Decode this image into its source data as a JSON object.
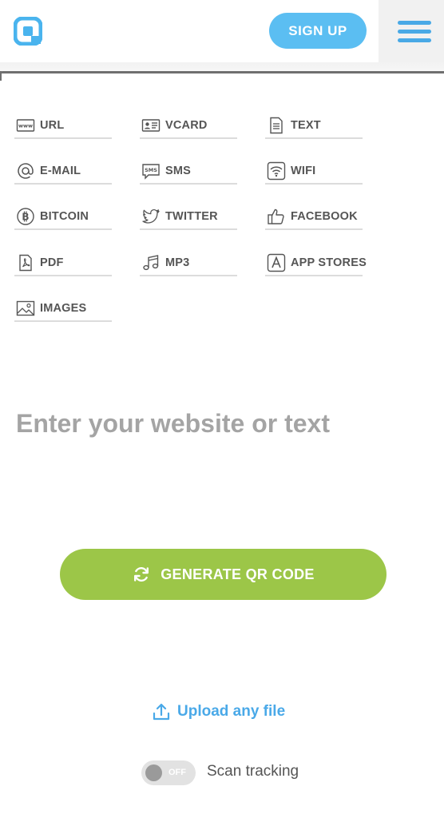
{
  "header": {
    "signup_label": "SIGN UP",
    "logo_icon": "rounded-square-logo-icon",
    "menu_icon": "hamburger-menu-icon",
    "brand_color": "#5bbef2"
  },
  "types": [
    {
      "label": "URL",
      "icon": "www-icon"
    },
    {
      "label": "VCARD",
      "icon": "vcard-icon"
    },
    {
      "label": "TEXT",
      "icon": "document-icon"
    },
    {
      "label": "E-MAIL",
      "icon": "at-icon"
    },
    {
      "label": "SMS",
      "icon": "sms-bubble-icon"
    },
    {
      "label": "WIFI",
      "icon": "wifi-icon"
    },
    {
      "label": "BITCOIN",
      "icon": "bitcoin-icon"
    },
    {
      "label": "TWITTER",
      "icon": "twitter-bird-icon"
    },
    {
      "label": "FACEBOOK",
      "icon": "thumbs-up-icon"
    },
    {
      "label": "PDF",
      "icon": "pdf-file-icon"
    },
    {
      "label": "MP3",
      "icon": "music-note-icon"
    },
    {
      "label": "APP STORES",
      "icon": "app-store-icon"
    },
    {
      "label": "IMAGES",
      "icon": "image-icon"
    }
  ],
  "input": {
    "placeholder": "Enter your website or text",
    "value": ""
  },
  "generate": {
    "label": "GENERATE QR CODE",
    "icon": "refresh-icon",
    "color": "#9cc648"
  },
  "upload": {
    "label": "Upload any file",
    "icon": "upload-icon",
    "color": "#4aa9e8"
  },
  "tracking": {
    "state_label": "OFF",
    "label": "Scan tracking"
  }
}
